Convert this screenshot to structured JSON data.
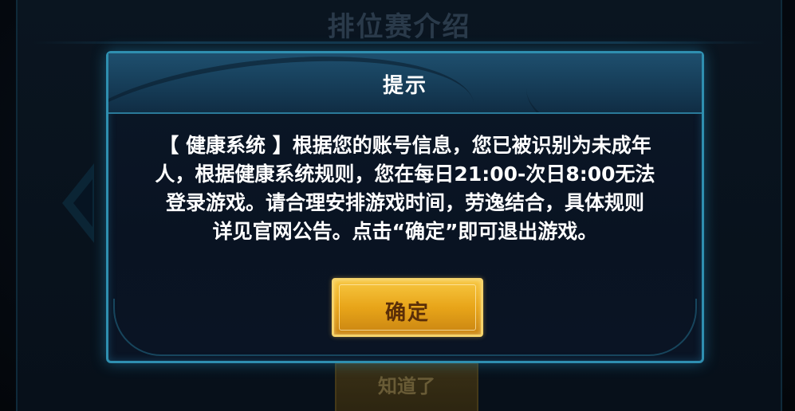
{
  "background": {
    "title": "排位赛介绍",
    "button_label": "知道了"
  },
  "dialog": {
    "title": "提示",
    "message_lines": [
      "【 健康系统 】根据您的账号信息，您已被识别为未成年",
      "人，根据健康系统规则，您在每日21:00-次日8:00无法",
      "登录游戏。请合理安排游戏时间，劳逸结合，具体规则",
      "详见官网公告。点击“确定”即可退出游戏。"
    ],
    "confirm_label": "确定"
  },
  "colors": {
    "accent_border": "#2f8fb0",
    "button_gold": "#e8a519",
    "text": "#ffffff"
  }
}
